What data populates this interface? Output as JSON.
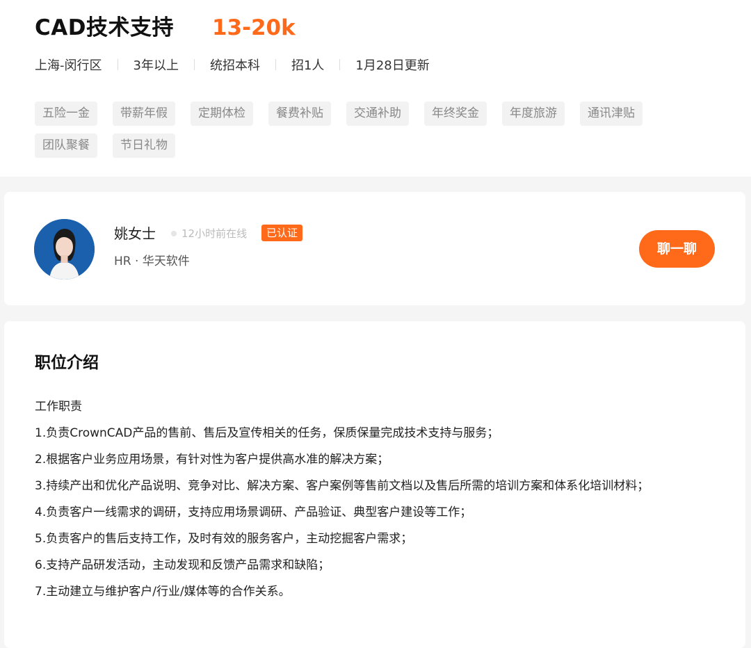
{
  "job": {
    "title": "CAD技术支持",
    "salary": "13-20k",
    "meta": [
      "上海-闵行区",
      "3年以上",
      "统招本科",
      "招1人",
      "1月28日更新"
    ],
    "tags": [
      "五险一金",
      "带薪年假",
      "定期体检",
      "餐费补贴",
      "交通补助",
      "年终奖金",
      "年度旅游",
      "通讯津贴",
      "团队聚餐",
      "节日礼物"
    ]
  },
  "hr": {
    "name": "姚女士",
    "online": "12小时前在线",
    "verified": "已认证",
    "subtitle": "HR · 华天软件",
    "chat_label": "聊一聊"
  },
  "description": {
    "title": "职位介绍",
    "lines": [
      "工作职责",
      "1.负责CrownCAD产品的售前、售后及宣传相关的任务，保质保量完成技术支持与服务；",
      "2.根据客户业务应用场景，有针对性为客户提供高水准的解决方案；",
      "3.持续产出和优化产品说明、竞争对比、解决方案、客户案例等售前文档以及售后所需的培训方案和体系化培训材料；",
      "4.负责客户一线需求的调研，支持应用场景调研、产品验证、典型客户建设等工作；",
      "5.负责客户的售后支持工作，及时有效的服务客户，主动挖掘客户需求；",
      "6.支持产品研发活动，主动发现和反馈产品需求和缺陷；",
      "7.主动建立与维护客户/行业/媒体等的合作关系。"
    ]
  },
  "colors": {
    "accent": "#ff6a1a",
    "tag_bg": "#f2f2f2",
    "page_bg": "#f5f5f5"
  }
}
